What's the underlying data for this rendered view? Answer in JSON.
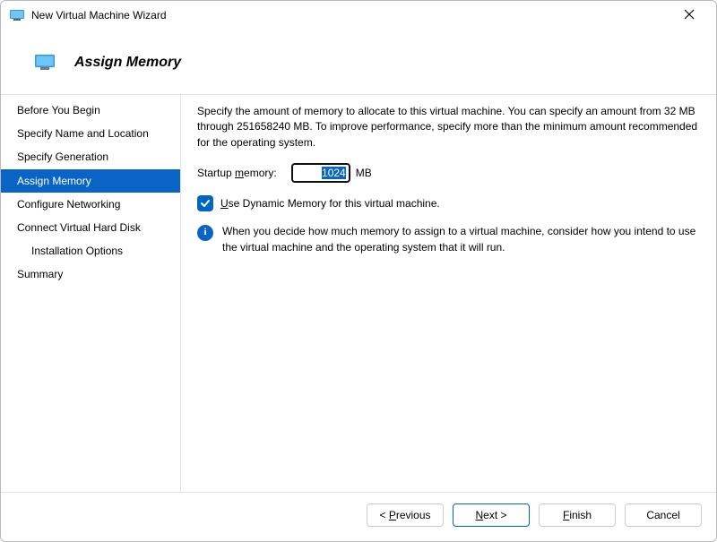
{
  "window": {
    "title": "New Virtual Machine Wizard"
  },
  "header": {
    "title": "Assign Memory"
  },
  "sidebar": {
    "items": [
      {
        "label": "Before You Begin",
        "selected": false,
        "indent": false
      },
      {
        "label": "Specify Name and Location",
        "selected": false,
        "indent": false
      },
      {
        "label": "Specify Generation",
        "selected": false,
        "indent": false
      },
      {
        "label": "Assign Memory",
        "selected": true,
        "indent": false
      },
      {
        "label": "Configure Networking",
        "selected": false,
        "indent": false
      },
      {
        "label": "Connect Virtual Hard Disk",
        "selected": false,
        "indent": false
      },
      {
        "label": "Installation Options",
        "selected": false,
        "indent": true
      },
      {
        "label": "Summary",
        "selected": false,
        "indent": false
      }
    ]
  },
  "content": {
    "description": "Specify the amount of memory to allocate to this virtual machine. You can specify an amount from 32 MB through 251658240 MB. To improve performance, specify more than the minimum amount recommended for the operating system.",
    "memory_label_pre": "Startup ",
    "memory_label_u": "m",
    "memory_label_post": "emory:",
    "memory_value": "1024",
    "memory_unit": "MB",
    "dynamic_checked": true,
    "dynamic_label_u": "U",
    "dynamic_label_post": "se Dynamic Memory for this virtual machine.",
    "info_text": "When you decide how much memory to assign to a virtual machine, consider how you intend to use the virtual machine and the operating system that it will run."
  },
  "footer": {
    "previous_pre": "< ",
    "previous_u": "P",
    "previous_post": "revious",
    "next_u": "N",
    "next_post": "ext >",
    "finish_u": "F",
    "finish_post": "inish",
    "cancel": "Cancel"
  }
}
